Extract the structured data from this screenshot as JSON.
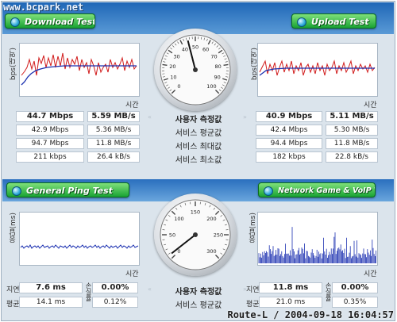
{
  "watermark": "www.bcpark.net",
  "download_test": {
    "label": "Download Test",
    "ylabel": "bps(대역)",
    "xlabel": "시간",
    "current": {
      "mbps": "44.7 Mbps",
      "mbs": "5.59 MB/s"
    },
    "avg": {
      "mbps": "42.9 Mbps",
      "mbs": "5.36 MB/s"
    },
    "max": {
      "mbps": "94.7 Mbps",
      "mbs": "11.8 MB/s"
    },
    "min": {
      "mbps": "211 kbps",
      "mbs": "26.4 kB/s"
    }
  },
  "upload_test": {
    "label": "Upload Test",
    "ylabel": "bps(대역)",
    "xlabel": "시간",
    "current": {
      "mbps": "40.9 Mbps",
      "mbs": "5.11 MB/s"
    },
    "avg": {
      "mbps": "42.4 Mbps",
      "mbs": "5.30 MB/s"
    },
    "max": {
      "mbps": "94.4 Mbps",
      "mbs": "11.8 MB/s"
    },
    "min": {
      "mbps": "182 kbps",
      "mbs": "22.8 kB/s"
    }
  },
  "middle_labels": {
    "current": "사용자 측정값",
    "avg": "서비스 평균값",
    "max": "서비스 최대값",
    "min": "서비스 최소값"
  },
  "speed_gauge": {
    "ticks": [
      "0",
      "10",
      "20",
      "30",
      "40",
      "50",
      "60",
      "70",
      "80",
      "90",
      "100"
    ],
    "unit": "Mbps",
    "needle_value": 44.7
  },
  "ping_test": {
    "label": "General Ping Test",
    "ylabel": "응답(ms)",
    "xlabel": "시간",
    "current": {
      "latency": "7.6 ms",
      "loss": "0.00%"
    },
    "avg": {
      "latency": "14.1 ms",
      "loss": "0.12%"
    },
    "row_label_latency": "지연",
    "row_label_avg": "평균",
    "loss_label": "손실률"
  },
  "game_test": {
    "label": "Network Game & VoIP Test",
    "ylabel": "응답(ms)",
    "xlabel": "시간",
    "current": {
      "latency": "11.8 ms",
      "loss": "0.00%"
    },
    "avg": {
      "latency": "21.0 ms",
      "loss": "0.35%"
    },
    "row_label_latency": "지연",
    "row_label_avg": "평균",
    "loss_label": "손실률"
  },
  "ping_middle_labels": {
    "current": "사용자 측정값",
    "avg": "서비스 평균값"
  },
  "ping_gauge": {
    "ticks": [
      "0",
      "50",
      "100",
      "150",
      "200",
      "250",
      "300"
    ],
    "unit": "ms",
    "needle_value": 7.6
  },
  "route_stamp": "Route-L / 2004-09-18 16:04:57",
  "colors": {
    "accent_blue": "#1f67b7",
    "button_green": "#19a334",
    "series_red": "#d11b1b",
    "series_blue": "#1a2fb0"
  }
}
